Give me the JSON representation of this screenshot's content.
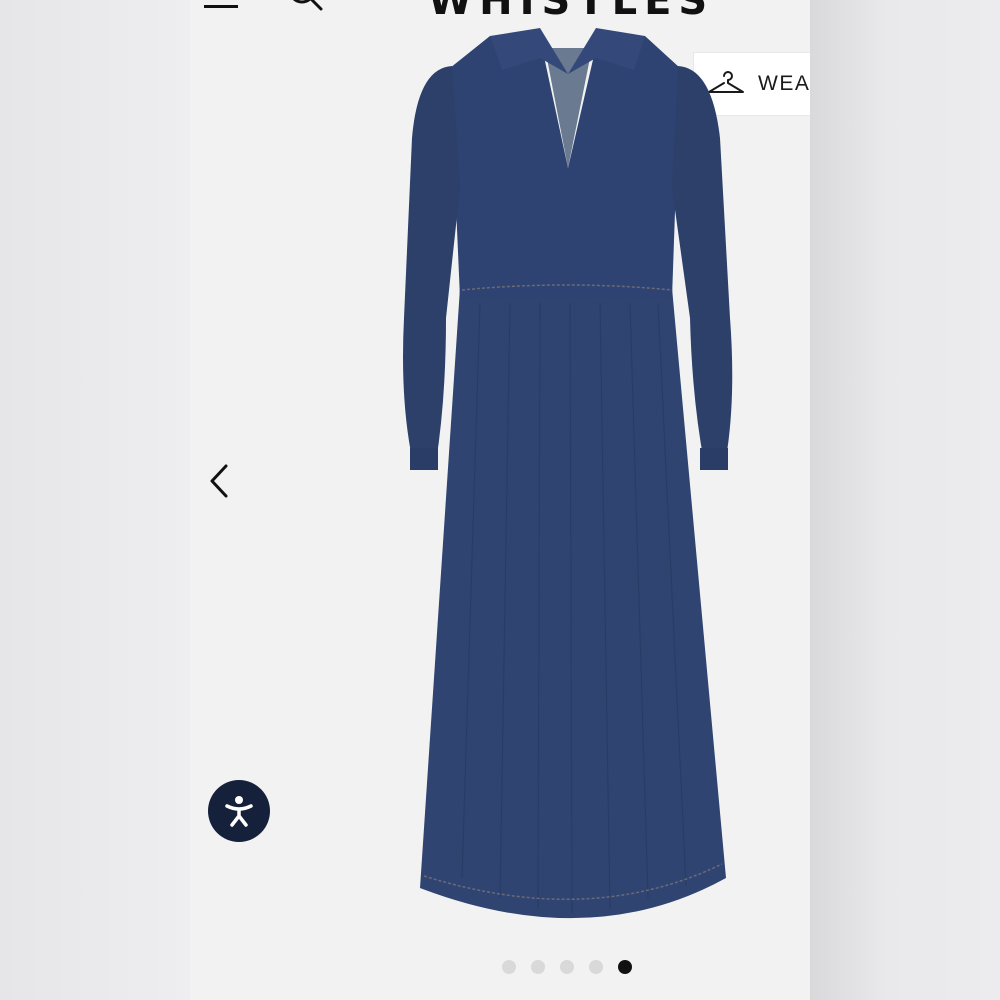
{
  "header": {
    "brand": "WHISTLES"
  },
  "wear_badge": {
    "label": "WEAI",
    "icon": "hanger-icon"
  },
  "gallery": {
    "prev_icon": "chevron-left-icon",
    "product_image": "denim-midi-dress",
    "dots_total": 5,
    "active_dot": 5
  },
  "accessibility": {
    "icon": "accessibility-icon",
    "color": "#15203a"
  },
  "colors": {
    "denim": "#2f4470",
    "dot_inactive": "#d9d9d9",
    "dot_active": "#111111"
  }
}
